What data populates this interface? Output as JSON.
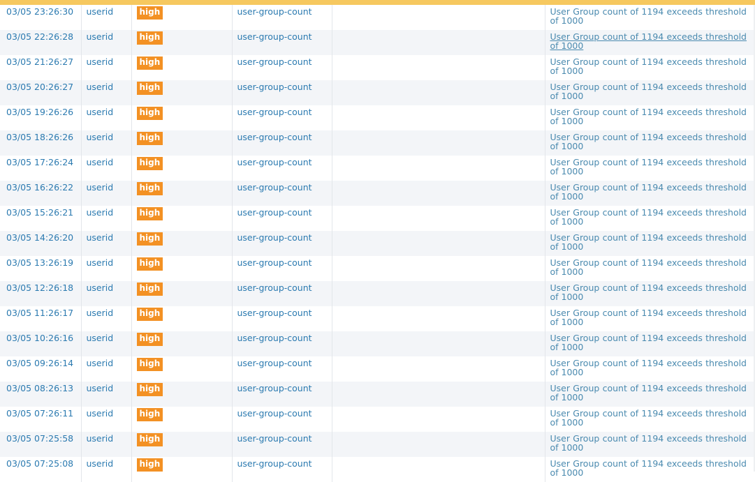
{
  "colors": {
    "severity_high": "#f39124",
    "link_text": "#2b7ab0",
    "top_strip": "#f6c85f"
  },
  "rows": [
    {
      "time": "03/05 23:26:30",
      "type": "userid",
      "severity": "high",
      "event": "user-group-count",
      "description": "User Group count of 1194 exceeds threshold of 1000"
    },
    {
      "time": "03/05 22:26:28",
      "type": "userid",
      "severity": "high",
      "event": "user-group-count",
      "description": "User Group count of 1194 exceeds threshold of 1000"
    },
    {
      "time": "03/05 21:26:27",
      "type": "userid",
      "severity": "high",
      "event": "user-group-count",
      "description": "User Group count of 1194 exceeds threshold of 1000"
    },
    {
      "time": "03/05 20:26:27",
      "type": "userid",
      "severity": "high",
      "event": "user-group-count",
      "description": "User Group count of 1194 exceeds threshold of 1000"
    },
    {
      "time": "03/05 19:26:26",
      "type": "userid",
      "severity": "high",
      "event": "user-group-count",
      "description": "User Group count of 1194 exceeds threshold of 1000"
    },
    {
      "time": "03/05 18:26:26",
      "type": "userid",
      "severity": "high",
      "event": "user-group-count",
      "description": "User Group count of 1194 exceeds threshold of 1000"
    },
    {
      "time": "03/05 17:26:24",
      "type": "userid",
      "severity": "high",
      "event": "user-group-count",
      "description": "User Group count of 1194 exceeds threshold of 1000"
    },
    {
      "time": "03/05 16:26:22",
      "type": "userid",
      "severity": "high",
      "event": "user-group-count",
      "description": "User Group count of 1194 exceeds threshold of 1000"
    },
    {
      "time": "03/05 15:26:21",
      "type": "userid",
      "severity": "high",
      "event": "user-group-count",
      "description": "User Group count of 1194 exceeds threshold of 1000"
    },
    {
      "time": "03/05 14:26:20",
      "type": "userid",
      "severity": "high",
      "event": "user-group-count",
      "description": "User Group count of 1194 exceeds threshold of 1000"
    },
    {
      "time": "03/05 13:26:19",
      "type": "userid",
      "severity": "high",
      "event": "user-group-count",
      "description": "User Group count of 1194 exceeds threshold of 1000"
    },
    {
      "time": "03/05 12:26:18",
      "type": "userid",
      "severity": "high",
      "event": "user-group-count",
      "description": "User Group count of 1194 exceeds threshold of 1000"
    },
    {
      "time": "03/05 11:26:17",
      "type": "userid",
      "severity": "high",
      "event": "user-group-count",
      "description": "User Group count of 1194 exceeds threshold of 1000"
    },
    {
      "time": "03/05 10:26:16",
      "type": "userid",
      "severity": "high",
      "event": "user-group-count",
      "description": "User Group count of 1194 exceeds threshold of 1000"
    },
    {
      "time": "03/05 09:26:14",
      "type": "userid",
      "severity": "high",
      "event": "user-group-count",
      "description": "User Group count of 1194 exceeds threshold of 1000"
    },
    {
      "time": "03/05 08:26:13",
      "type": "userid",
      "severity": "high",
      "event": "user-group-count",
      "description": "User Group count of 1194 exceeds threshold of 1000"
    },
    {
      "time": "03/05 07:26:11",
      "type": "userid",
      "severity": "high",
      "event": "user-group-count",
      "description": "User Group count of 1194 exceeds threshold of 1000"
    },
    {
      "time": "03/05 07:25:58",
      "type": "userid",
      "severity": "high",
      "event": "user-group-count",
      "description": "User Group count of 1194 exceeds threshold of 1000"
    },
    {
      "time": "03/05 07:25:08",
      "type": "userid",
      "severity": "high",
      "event": "user-group-count",
      "description": "User Group count of 1194 exceeds threshold of 1000"
    }
  ]
}
